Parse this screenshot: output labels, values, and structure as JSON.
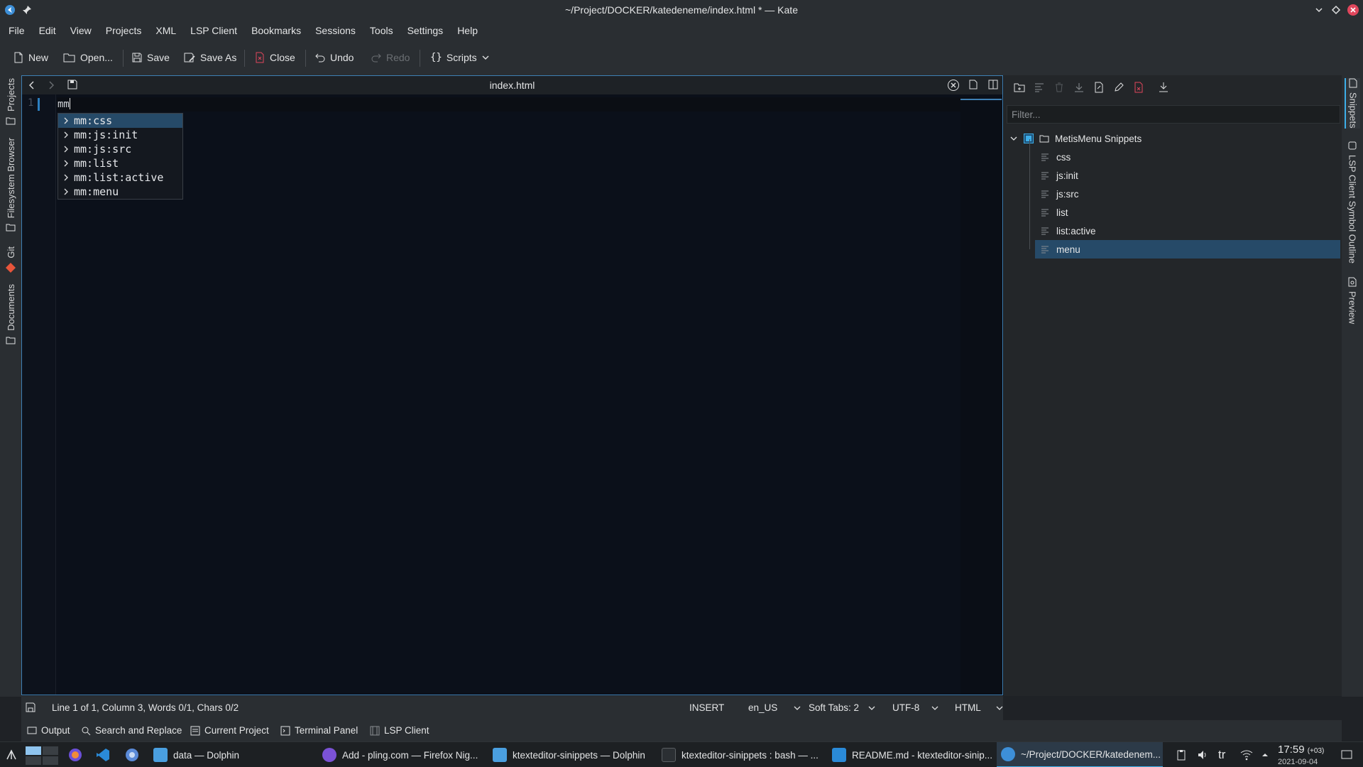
{
  "window": {
    "title": "~/Project/DOCKER/katedeneme/index.html * — Kate"
  },
  "menubar": [
    "File",
    "Edit",
    "View",
    "Projects",
    "XML",
    "LSP Client",
    "Bookmarks",
    "Sessions",
    "Tools",
    "Settings",
    "Help"
  ],
  "toolbar": {
    "new": "New",
    "open": "Open...",
    "save": "Save",
    "save_as": "Save As",
    "close": "Close",
    "undo": "Undo",
    "redo": "Redo",
    "scripts": "Scripts"
  },
  "left_tabs": [
    "Projects",
    "Filesystem Browser",
    "Git",
    "Documents"
  ],
  "editor": {
    "tab_name": "index.html",
    "line_number": "1",
    "line_text": "mm"
  },
  "completion": [
    "mm:css",
    "mm:js:init",
    "mm:js:src",
    "mm:list",
    "mm:list:active",
    "mm:menu"
  ],
  "snippets": {
    "filter_placeholder": "Filter...",
    "repository": "MetisMenu Snippets",
    "items": [
      "css",
      "js:init",
      "js:src",
      "list",
      "list:active",
      "menu"
    ],
    "selected": "menu"
  },
  "right_tabs": [
    "Snippets",
    "LSP Client Symbol Outline",
    "Preview"
  ],
  "status": {
    "position": "Line 1 of 1, Column 3, Words 0/1, Chars 0/2",
    "mode": "INSERT",
    "language": "en_US",
    "indent": "Soft Tabs: 2",
    "encoding": "UTF-8",
    "syntax": "HTML"
  },
  "bottom_tabs": [
    "Output",
    "Search and Replace",
    "Current Project",
    "Terminal Panel",
    "LSP Client"
  ],
  "taskbar": {
    "tasks": [
      "data — Dolphin",
      "Add - pling.com — Firefox Nig...",
      "ktexteditor-sinippets — Dolphin",
      "ktexteditor-sinippets : bash — ...",
      "README.md - ktexteditor-sinip...",
      "~/Project/DOCKER/katedenem..."
    ],
    "keyboard": "tr",
    "time": "17:59",
    "tz": "(+03)",
    "date": "2021-09-04"
  },
  "colors": {
    "accent": "#3daee9",
    "selection": "#264a68",
    "editor_bg": "#0b101a",
    "chrome": "#2a2e32"
  }
}
